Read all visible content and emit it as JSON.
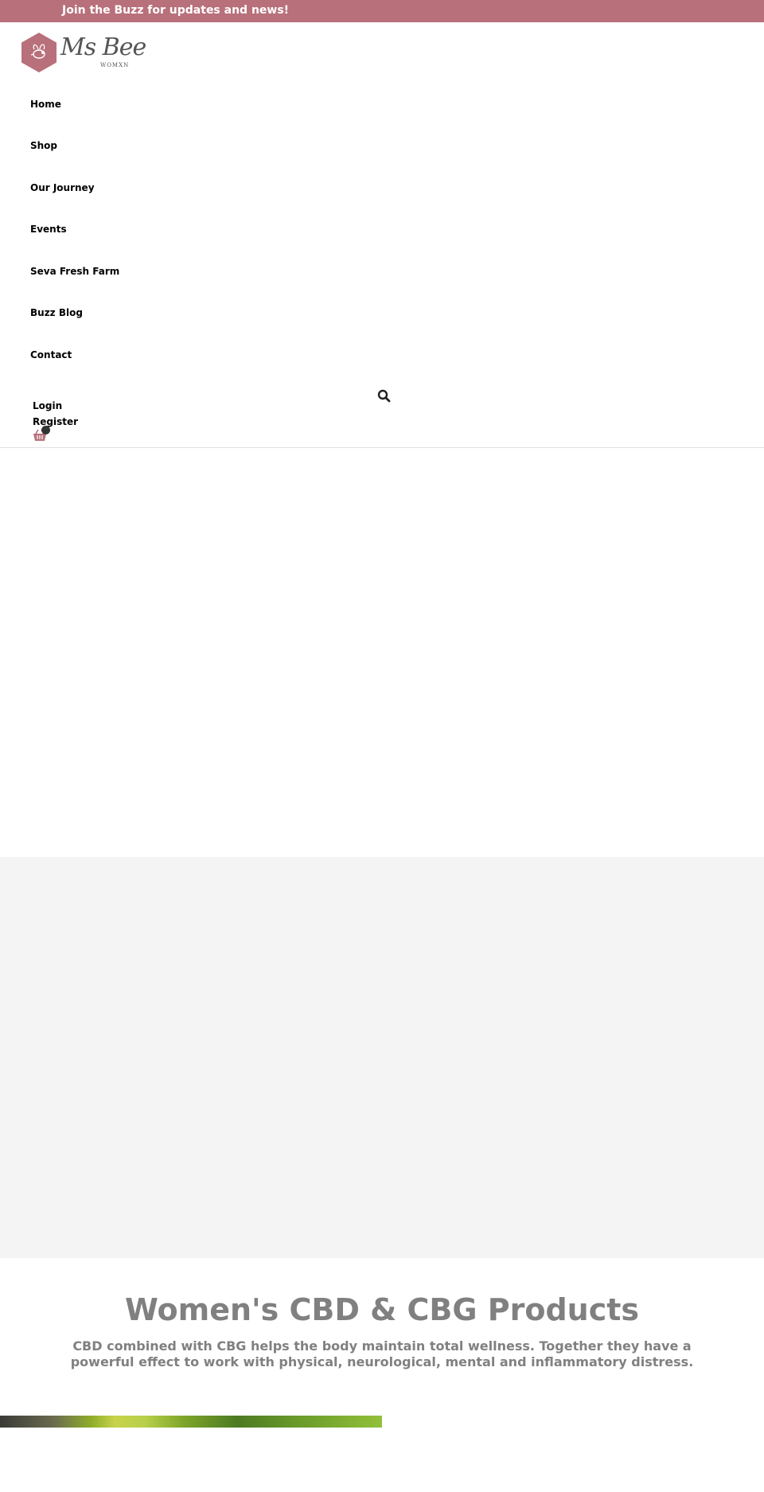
{
  "topbar": {
    "text": "Join the Buzz for updates and news!",
    "background": "#b8707b"
  },
  "logo": {
    "text": "Ms Bee",
    "subtext": "WOMXN",
    "color": "#b8707b"
  },
  "nav": {
    "items": [
      {
        "label": "Home"
      },
      {
        "label": "Shop"
      },
      {
        "label": "Our Journey"
      },
      {
        "label": "Events"
      },
      {
        "label": "Seva Fresh Farm"
      },
      {
        "label": "Buzz Blog"
      },
      {
        "label": "Contact"
      }
    ]
  },
  "account": {
    "login": "Login",
    "register": "Register"
  },
  "icons": {
    "search": "search-icon",
    "cart": "basket-icon"
  },
  "main": {
    "heading": "Women's CBD & CBG Products",
    "subheading": "CBD combined with CBG helps the body maintain total wellness. Together they have a powerful effect to work with physical, neurological, mental and inflammatory distress."
  },
  "colors": {
    "accent": "#b8707b",
    "heading_text": "#808080",
    "band_background": "#f4f4f4"
  }
}
